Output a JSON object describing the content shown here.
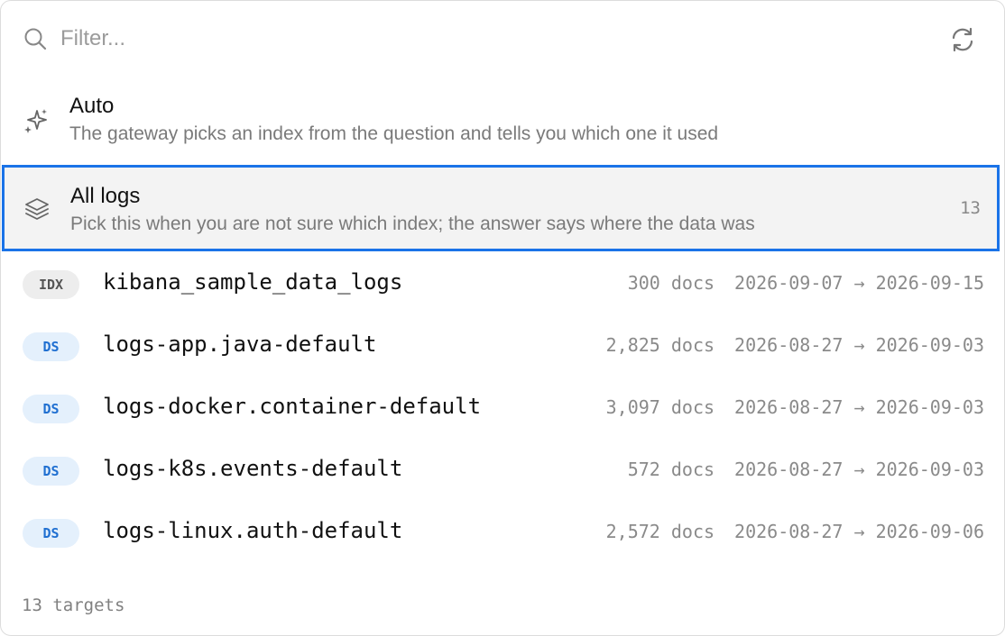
{
  "search": {
    "placeholder": "Filter...",
    "value": ""
  },
  "options": [
    {
      "icon": "sparkle-icon",
      "title": "Auto",
      "description": "The gateway picks an index from the question and tells you which one it used"
    },
    {
      "icon": "layers-icon",
      "title": "All logs",
      "description": "Pick this when you are not sure which index; the answer says where the data was",
      "count": "13",
      "selected": true
    }
  ],
  "indices": [
    {
      "badge": "IDX",
      "name": "kibana_sample_data_logs",
      "docs": "300 docs",
      "range": "2026-09-07 → 2026-09-15"
    },
    {
      "badge": "DS",
      "name": "logs-app.java-default",
      "docs": "2,825 docs",
      "range": "2026-08-27 → 2026-09-03"
    },
    {
      "badge": "DS",
      "name": "logs-docker.container-default",
      "docs": "3,097 docs",
      "range": "2026-08-27 → 2026-09-03"
    },
    {
      "badge": "DS",
      "name": "logs-k8s.events-default",
      "docs": "572 docs",
      "range": "2026-08-27 → 2026-09-03"
    },
    {
      "badge": "DS",
      "name": "logs-linux.auth-default",
      "docs": "2,572 docs",
      "range": "2026-08-27 → 2026-09-06"
    }
  ],
  "footer": {
    "count_label": "13 targets"
  },
  "colors": {
    "selection_border": "#1a73e8",
    "selected_bg": "#f3f3f3",
    "ds_badge_bg": "#e4f0fc",
    "ds_badge_text": "#1f6fd1",
    "idx_badge_bg": "#ededed"
  }
}
